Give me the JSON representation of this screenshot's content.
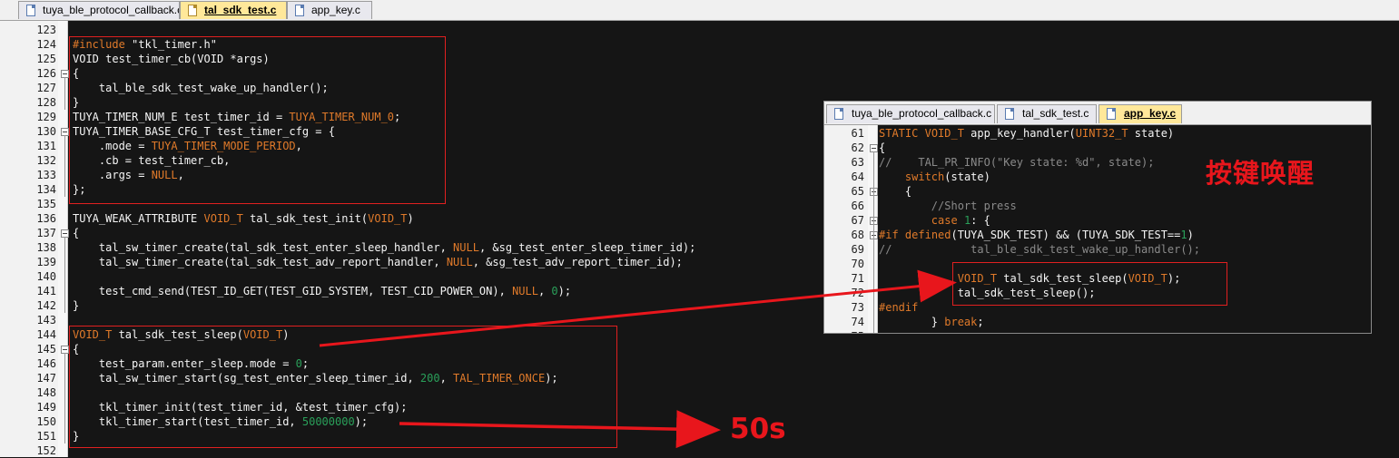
{
  "tabs": [
    {
      "label": "tuya_ble_protocol_callback.c",
      "active": false
    },
    {
      "label": "tal_sdk_test.c",
      "active": true
    },
    {
      "label": "app_key.c",
      "active": false
    }
  ],
  "main_lines": [
    {
      "num": "123",
      "code": ""
    },
    {
      "num": "124",
      "code": "#include \"tkl_timer.h\""
    },
    {
      "num": "125",
      "code": "VOID test_timer_cb(VOID *args)"
    },
    {
      "num": "126",
      "code": "{"
    },
    {
      "num": "127",
      "code": "    tal_ble_sdk_test_wake_up_handler();"
    },
    {
      "num": "128",
      "code": "}"
    },
    {
      "num": "129",
      "code": "TUYA_TIMER_NUM_E test_timer_id = TUYA_TIMER_NUM_0;"
    },
    {
      "num": "130",
      "code": "TUYA_TIMER_BASE_CFG_T test_timer_cfg = {"
    },
    {
      "num": "131",
      "code": "    .mode = TUYA_TIMER_MODE_PERIOD,"
    },
    {
      "num": "132",
      "code": "    .cb = test_timer_cb,"
    },
    {
      "num": "133",
      "code": "    .args = NULL,"
    },
    {
      "num": "134",
      "code": "};"
    },
    {
      "num": "135",
      "code": ""
    },
    {
      "num": "136",
      "code": "TUYA_WEAK_ATTRIBUTE VOID_T tal_sdk_test_init(VOID_T)"
    },
    {
      "num": "137",
      "code": "{"
    },
    {
      "num": "138",
      "code": "    tal_sw_timer_create(tal_sdk_test_enter_sleep_handler, NULL, &sg_test_enter_sleep_timer_id);"
    },
    {
      "num": "139",
      "code": "    tal_sw_timer_create(tal_sdk_test_adv_report_handler, NULL, &sg_test_adv_report_timer_id);"
    },
    {
      "num": "140",
      "code": ""
    },
    {
      "num": "141",
      "code": "    test_cmd_send(TEST_ID_GET(TEST_GID_SYSTEM, TEST_CID_POWER_ON), NULL, 0);"
    },
    {
      "num": "142",
      "code": "}"
    },
    {
      "num": "143",
      "code": ""
    },
    {
      "num": "144",
      "code": "VOID_T tal_sdk_test_sleep(VOID_T)"
    },
    {
      "num": "145",
      "code": "{"
    },
    {
      "num": "146",
      "code": "    test_param.enter_sleep.mode = 0;"
    },
    {
      "num": "147",
      "code": "    tal_sw_timer_start(sg_test_enter_sleep_timer_id, 200, TAL_TIMER_ONCE);"
    },
    {
      "num": "148",
      "code": ""
    },
    {
      "num": "149",
      "code": "    tkl_timer_init(test_timer_id, &test_timer_cfg);"
    },
    {
      "num": "150",
      "code": "    tkl_timer_start(test_timer_id, 50000000);"
    },
    {
      "num": "151",
      "code": "}"
    },
    {
      "num": "152",
      "code": ""
    }
  ],
  "inset": {
    "tabs": [
      {
        "label": "tuya_ble_protocol_callback.c",
        "active": false
      },
      {
        "label": "tal_sdk_test.c",
        "active": false
      },
      {
        "label": "app_key.c",
        "active": true
      }
    ],
    "lines": [
      {
        "num": "61",
        "code": "STATIC VOID_T app_key_handler(UINT32_T state)"
      },
      {
        "num": "62",
        "code": "{"
      },
      {
        "num": "63",
        "code": "//    TAL_PR_INFO(\"Key state: %d\", state);"
      },
      {
        "num": "64",
        "code": "    switch(state)"
      },
      {
        "num": "65",
        "code": "    {"
      },
      {
        "num": "66",
        "code": "        //Short press"
      },
      {
        "num": "67",
        "code": "        case 1: {"
      },
      {
        "num": "68",
        "code": "#if defined(TUYA_SDK_TEST) && (TUYA_SDK_TEST==1)"
      },
      {
        "num": "69",
        "code": "//            tal_ble_sdk_test_wake_up_handler();"
      },
      {
        "num": "70",
        "code": ""
      },
      {
        "num": "71",
        "code": "            VOID_T tal_sdk_test_sleep(VOID_T);"
      },
      {
        "num": "72",
        "code": "            tal_sdk_test_sleep();"
      },
      {
        "num": "73",
        "code": "#endif"
      },
      {
        "num": "74",
        "code": "        } break;"
      },
      {
        "num": "75",
        "code": ""
      }
    ]
  },
  "annotations": {
    "key_wakeup": "按键唤醒",
    "duration": "50s"
  },
  "colors": {
    "annotation_red": "#e8161c",
    "keyword": "#e07a2a",
    "number": "#2aa05a",
    "comment": "#8a8a8a",
    "editor_bg": "#151515"
  }
}
